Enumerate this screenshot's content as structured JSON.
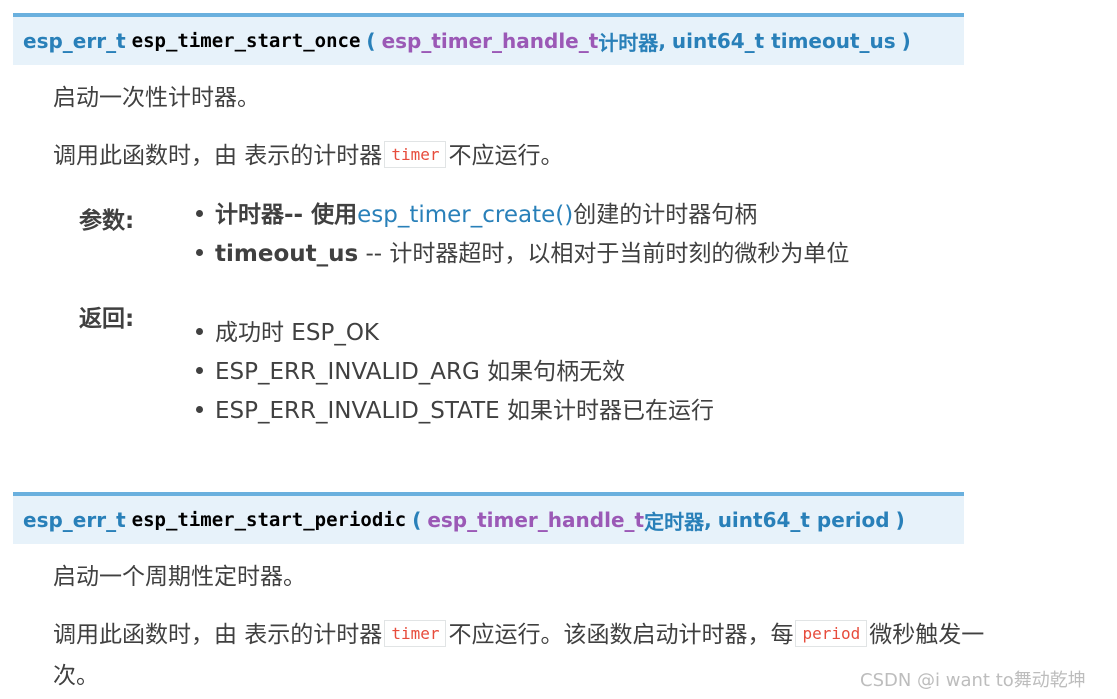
{
  "func1": {
    "ret_type": "esp_err_t",
    "name": "esp_timer_start_once",
    "open": "(",
    "param1_type": "esp_timer_handle_t",
    "param1_name": "计时器",
    "comma": ",",
    "param2": "uint64_t timeout_us",
    "close": ")",
    "desc": "启动一次性计时器。",
    "note_pre": "调用此函数时，由 表示的计时器",
    "note_code": "timer",
    "note_post": "不应运行。",
    "params_label": "参数:",
    "param_items": [
      {
        "bold": "计时器-- 使用",
        "link": "esp_timer_create()",
        "text": "创建的计时器句柄"
      },
      {
        "bold": "timeout_us",
        "link": "",
        "text": " -- 计时器超时，以相对于当前时刻的微秒为单位"
      }
    ],
    "returns_label": "返回:",
    "return_items": [
      "成功时 ESP_OK",
      "ESP_ERR_INVALID_ARG 如果句柄无效",
      "ESP_ERR_INVALID_STATE 如果计时器已在运行"
    ]
  },
  "func2": {
    "ret_type": "esp_err_t",
    "name": "esp_timer_start_periodic",
    "open": "(",
    "param1_type": "esp_timer_handle_t",
    "param1_name": "定时器",
    "comma": ",",
    "param2": "uint64_t period",
    "close": ")",
    "desc": "启动一个周期性定时器。",
    "note_pre": "调用此函数时，由 表示的计时器",
    "note_code": "timer",
    "note_mid": "不应运行。该函数启动计时器，每",
    "note_code2": "period",
    "note_post": "微秒触发一",
    "note_wrap": "次。"
  },
  "watermark": "CSDN @i want to舞动乾坤",
  "colors": {
    "sig_bg": "#e7f2fa",
    "sig_border": "#6ab0de",
    "link": "#2980b9",
    "param_type": "#9b59b6",
    "code": "#e74c3c"
  }
}
